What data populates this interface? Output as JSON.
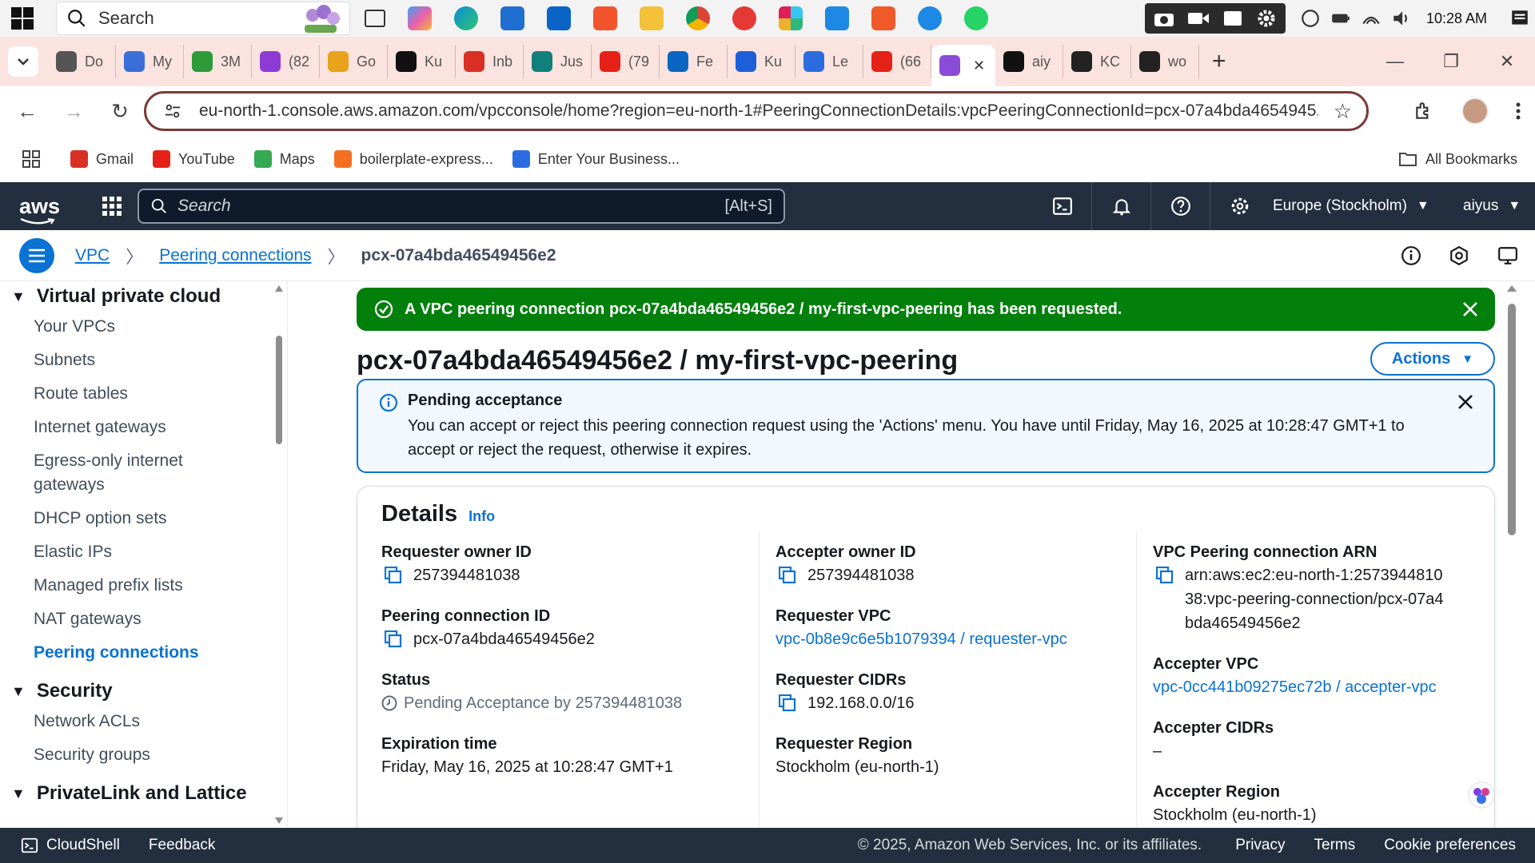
{
  "taskbar": {
    "search_placeholder": "Search",
    "time": "10:28 AM"
  },
  "browser": {
    "tabs": [
      {
        "label": "Do",
        "color": "#555555"
      },
      {
        "label": "My",
        "color": "#3b6fd8"
      },
      {
        "label": "3M",
        "color": "#2e9b3a"
      },
      {
        "label": "(82",
        "color": "#8e3bd6"
      },
      {
        "label": "Go",
        "color": "#e8a31a"
      },
      {
        "label": "Ku",
        "color": "#111111"
      },
      {
        "label": "Inb",
        "color": "#d93025"
      },
      {
        "label": "Jus",
        "color": "#12807a"
      },
      {
        "label": "(79",
        "color": "#e62117"
      },
      {
        "label": "Fe",
        "color": "#0a66c2"
      },
      {
        "label": "Ku",
        "color": "#1c5fd9"
      },
      {
        "label": "Le",
        "color": "#2d6cdf"
      },
      {
        "label": "(66",
        "color": "#e62117"
      },
      {
        "label": "",
        "color": "#8a4bd8",
        "active": true
      },
      {
        "label": "aiy",
        "color": "#111111"
      },
      {
        "label": "KC",
        "color": "#222222"
      },
      {
        "label": "wo",
        "color": "#222222"
      }
    ],
    "url": "eu-north-1.console.aws.amazon.com/vpcconsole/home?region=eu-north-1#PeeringConnectionDetails:vpcPeeringConnectionId=pcx-07a4bda4654945...",
    "bookmarks": [
      {
        "label": "Gmail",
        "color": "#d93025"
      },
      {
        "label": "YouTube",
        "color": "#e62117"
      },
      {
        "label": "Maps",
        "color": "#34a853"
      },
      {
        "label": "boilerplate-express...",
        "color": "#f36f21"
      },
      {
        "label": "Enter Your Business...",
        "color": "#2b6de0"
      }
    ],
    "all_bookmarks": "All Bookmarks"
  },
  "aws_nav": {
    "logo": "aws",
    "search_placeholder": "Search",
    "search_shortcut": "[Alt+S]",
    "region": "Europe (Stockholm)",
    "user": "aiyus"
  },
  "breadcrumb": {
    "items": [
      "VPC",
      "Peering connections"
    ],
    "current": "pcx-07a4bda46549456e2"
  },
  "sidebar": {
    "sections": [
      {
        "title": "Virtual private cloud",
        "items": [
          "Your VPCs",
          "Subnets",
          "Route tables",
          "Internet gateways",
          "Egress-only internet gateways",
          "DHCP option sets",
          "Elastic IPs",
          "Managed prefix lists",
          "NAT gateways",
          "Peering connections"
        ]
      },
      {
        "title": "Security",
        "items": [
          "Network ACLs",
          "Security groups"
        ]
      },
      {
        "title": "PrivateLink and Lattice",
        "items": []
      }
    ],
    "active_item": "Peering connections"
  },
  "flash": {
    "prefix": "A VPC peering connection ",
    "bold": "pcx-07a4bda46549456e2 / my-first-vpc-peering",
    "suffix": " has been requested."
  },
  "page": {
    "title": "pcx-07a4bda46549456e2 / my-first-vpc-peering",
    "actions_label": "Actions"
  },
  "alert": {
    "header": "Pending acceptance",
    "body": "You can accept or reject this peering connection request using the 'Actions' menu. You have until Friday, May 16, 2025 at 10:28:47 GMT+1 to accept or reject the request, otherwise it expires."
  },
  "details": {
    "title": "Details",
    "info_link": "Info",
    "requester_owner_id": {
      "label": "Requester owner ID",
      "value": "257394481038"
    },
    "peering_connection_id": {
      "label": "Peering connection ID",
      "value": "pcx-07a4bda46549456e2"
    },
    "status": {
      "label": "Status",
      "value": "Pending Acceptance by 257394481038"
    },
    "expiration_time": {
      "label": "Expiration time",
      "value": "Friday, May 16, 2025 at 10:28:47 GMT+1"
    },
    "accepter_owner_id": {
      "label": "Accepter owner ID",
      "value": "257394481038"
    },
    "requester_vpc": {
      "label": "Requester VPC",
      "value": "vpc-0b8e9c6e5b1079394 / requester-vpc"
    },
    "requester_cidrs": {
      "label": "Requester CIDRs",
      "value": "192.168.0.0/16"
    },
    "requester_region": {
      "label": "Requester Region",
      "value": "Stockholm (eu-north-1)"
    },
    "vpc_peering_arn": {
      "label": "VPC Peering connection ARN",
      "value": "arn:aws:ec2:eu-north-1:257394481038:vpc-peering-connection/pcx-07a4bda46549456e2"
    },
    "accepter_vpc": {
      "label": "Accepter VPC",
      "value": "vpc-0cc441b09275ec72b / accepter-vpc"
    },
    "accepter_cidrs": {
      "label": "Accepter CIDRs",
      "value": "–"
    },
    "accepter_region": {
      "label": "Accepter Region",
      "value": "Stockholm (eu-north-1)"
    }
  },
  "footer": {
    "cloudshell": "CloudShell",
    "feedback": "Feedback",
    "copyright": "© 2025, Amazon Web Services, Inc. or its affiliates.",
    "privacy": "Privacy",
    "terms": "Terms",
    "cookie_preferences": "Cookie preferences"
  },
  "colors": {
    "aws_nav_bg": "#232f3e",
    "link_blue": "#0972d3",
    "success_green": "#037f0c",
    "info_bg": "#f2f8fd",
    "tabstrip_bg": "#fbe3df"
  }
}
